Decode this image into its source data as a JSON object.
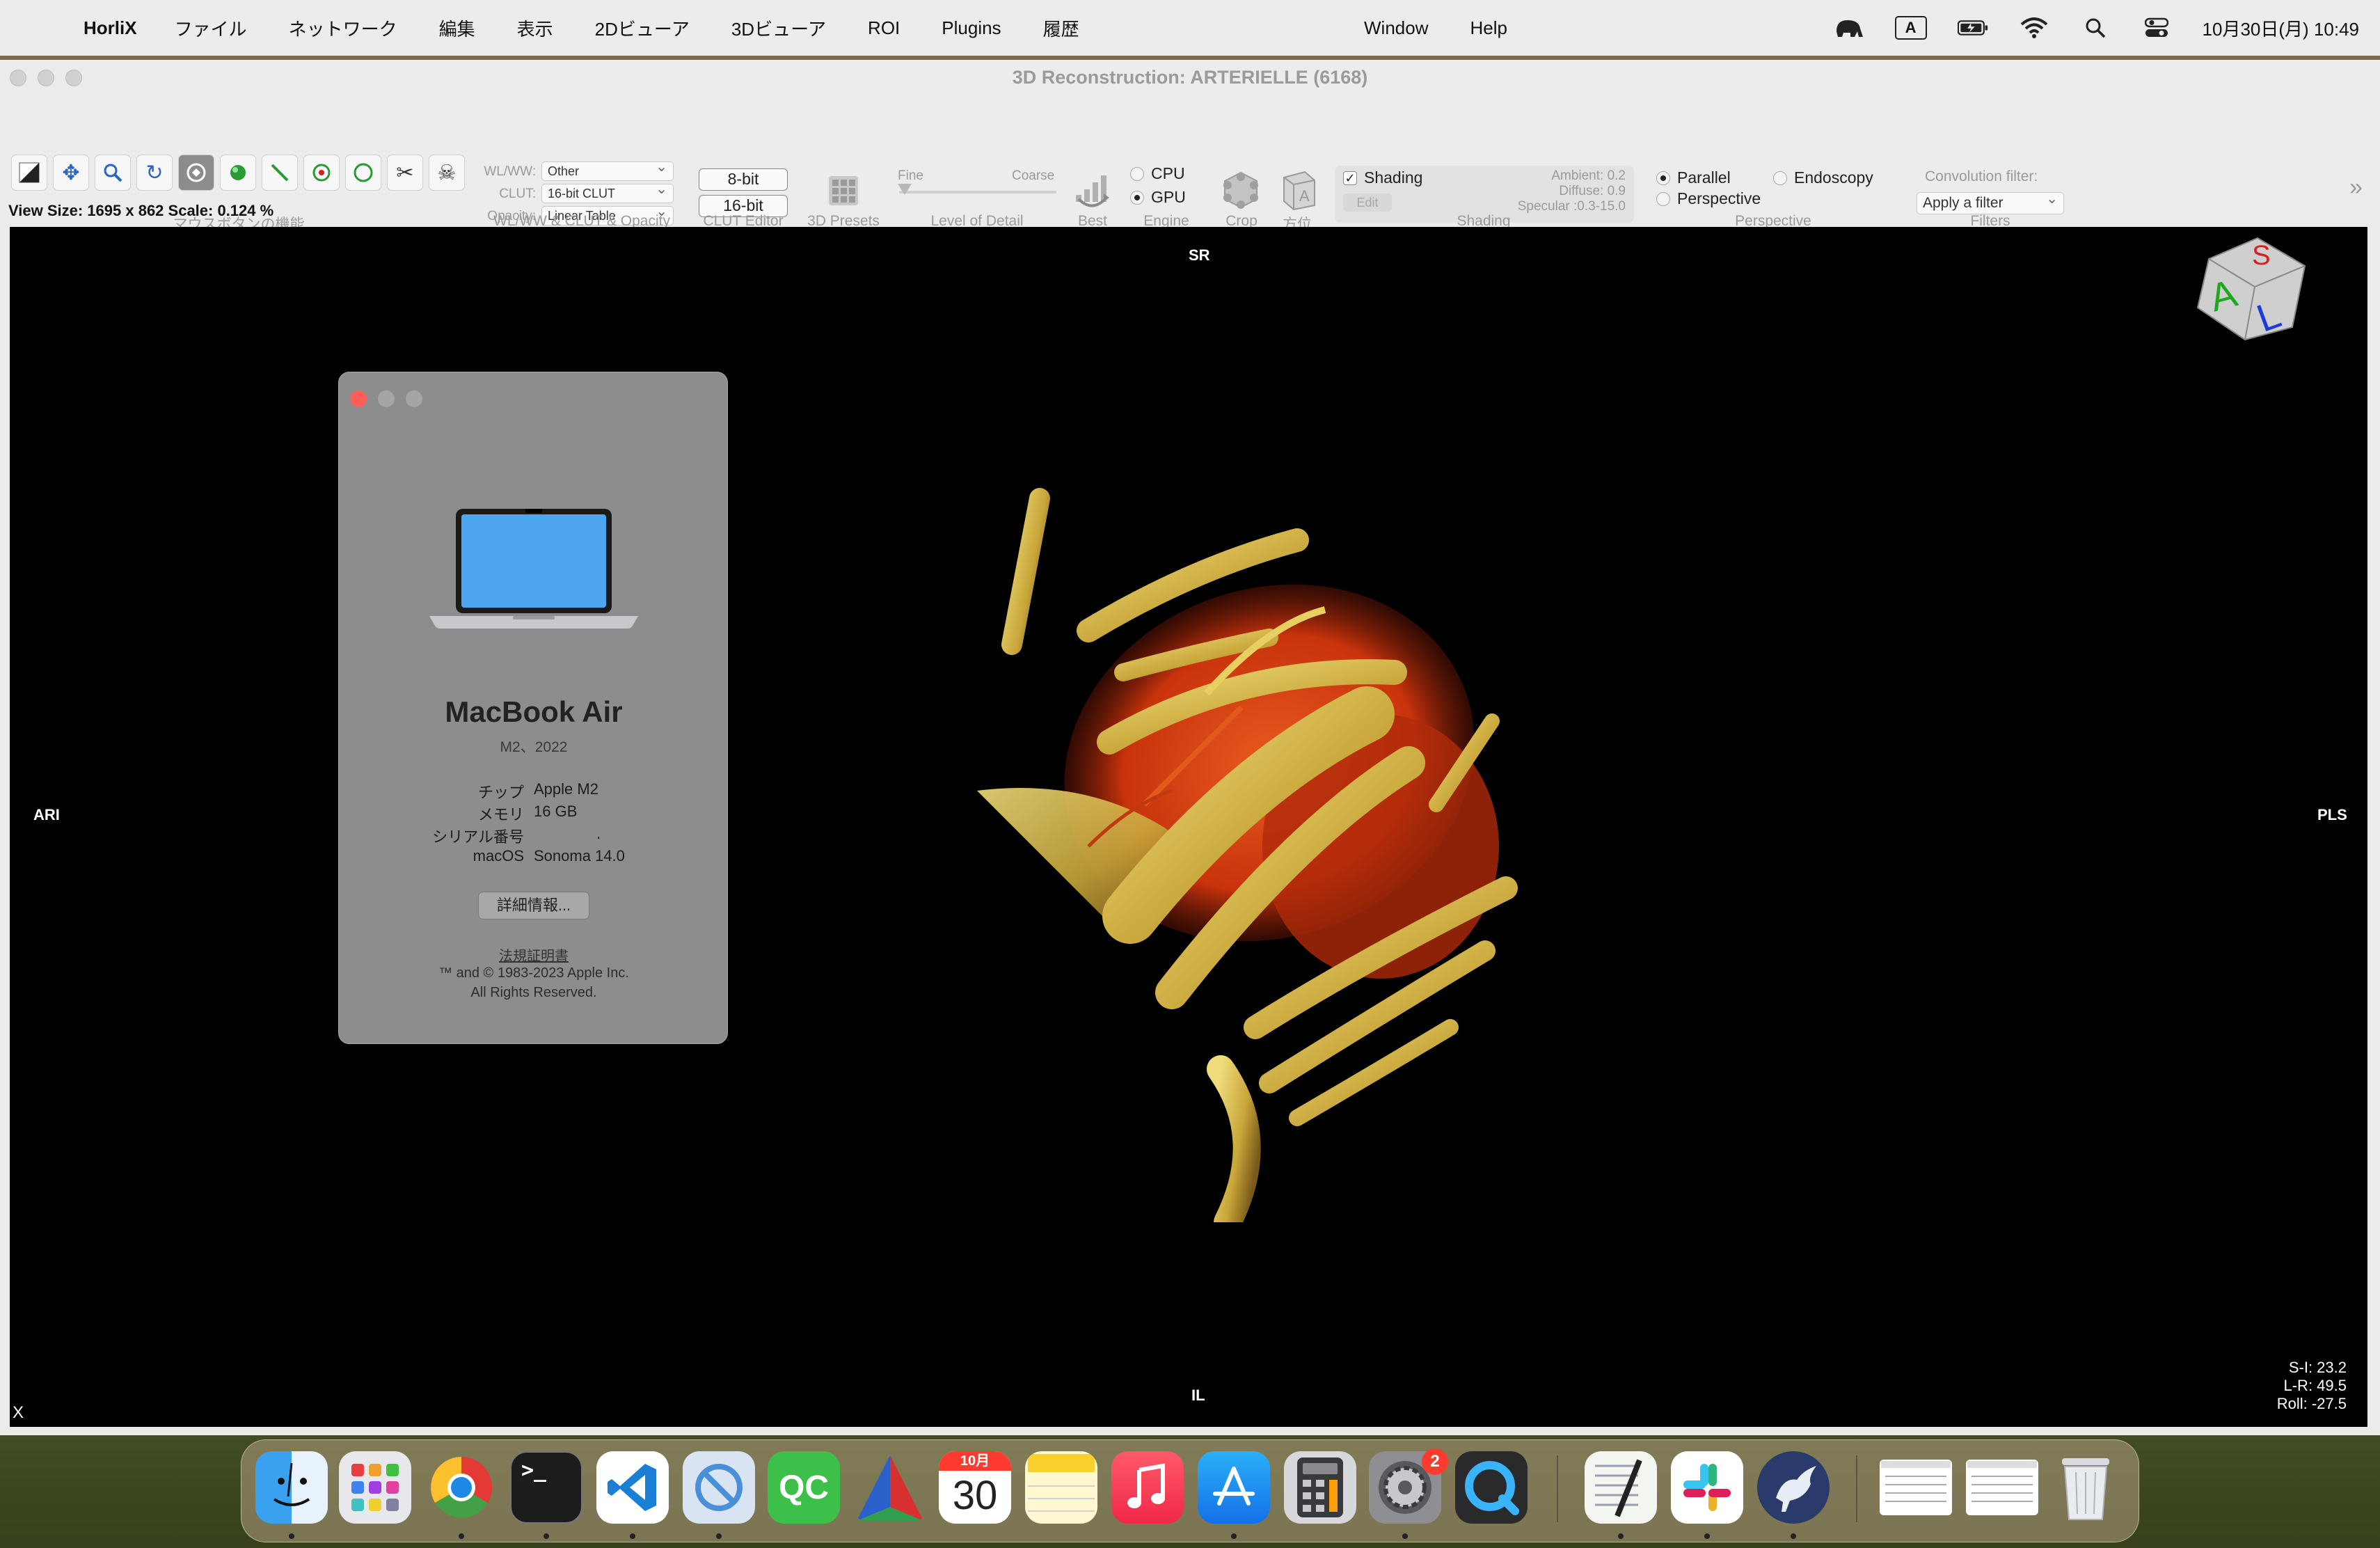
{
  "menubar": {
    "app_name": "HorliX",
    "menus": [
      "ファイル",
      "ネットワーク",
      "編集",
      "表示",
      "2Dビューア",
      "3Dビューア",
      "ROI",
      "Plugins",
      "履歴"
    ],
    "right_menus": [
      "Window",
      "Help"
    ],
    "ime_label": "A",
    "clock": "10月30日(月) 10:49"
  },
  "window": {
    "title": "3D Reconstruction: ARTERIELLE (6168)",
    "status_line": "View Size: 1695 x 862   Scale: 0.124 %"
  },
  "toolbar": {
    "groups": {
      "mouse_buttons": "マウスボタンの機能",
      "wlww_clut": "WL/WW & CLUT & Opacity",
      "clut_editor": "CLUT Editor",
      "presets": "3D Presets",
      "lod": "Level of Detail",
      "best": "Best",
      "engine": "Engine",
      "crop": "Crop",
      "orientation": "方位",
      "shading": "Shading",
      "perspective": "Perspective",
      "filters": "Filters"
    },
    "wlww_label": "WL/WW:",
    "wlww_value": "Other",
    "clut_label": "CLUT:",
    "clut_value": "16-bit CLUT",
    "opacity_label": "Opacity:",
    "opacity_value": "Linear Table",
    "bit8": "8-bit",
    "bit16": "16-bit",
    "lod_fine": "Fine",
    "lod_coarse": "Coarse",
    "engine_cpu": "CPU",
    "engine_gpu": "GPU",
    "engine_selected": "GPU",
    "shading_check": "Shading",
    "shading_edit": "Edit",
    "ambient": "Ambient: 0.2",
    "diffuse": "Diffuse: 0.9",
    "specular": "Specular :0.3-15.0",
    "proj_parallel": "Parallel",
    "proj_perspective": "Perspective",
    "proj_endoscopy": "Endoscopy",
    "convolution_label": "Convolution filter:",
    "convolution_value": "Apply a filter"
  },
  "viewport": {
    "orient_top": "SR",
    "orient_left": "ARI",
    "orient_right": "PLS",
    "orient_bottom": "IL",
    "readout_si": "S-I: 23.2",
    "readout_lr": "L-R: 49.5",
    "readout_roll": "Roll: -27.5",
    "corner_x": "X",
    "cube_letters": [
      "A",
      "L",
      "S"
    ]
  },
  "about": {
    "model": "MacBook Air",
    "sub": "M2、2022",
    "specs": [
      {
        "k": "チップ",
        "v": "Apple M2"
      },
      {
        "k": "メモリ",
        "v": "16 GB"
      },
      {
        "k": "シリアル番号",
        "v": "."
      },
      {
        "k": "macOS",
        "v": "Sonoma 14.0"
      }
    ],
    "more_button": "詳細情報...",
    "legal_link": "法規証明書",
    "copyright1": "™ and © 1983-2023 Apple Inc.",
    "copyright2": "All Rights Reserved."
  },
  "dock": {
    "calendar_month": "10月",
    "calendar_day": "30",
    "settings_badge": "2",
    "qc_label": "QC"
  },
  "colors": {
    "accent_red": "#ff5f57",
    "dock_badge": "#ff3b30",
    "vessel_orange": "#d8400f",
    "bone_yellow": "#d8c04a"
  }
}
